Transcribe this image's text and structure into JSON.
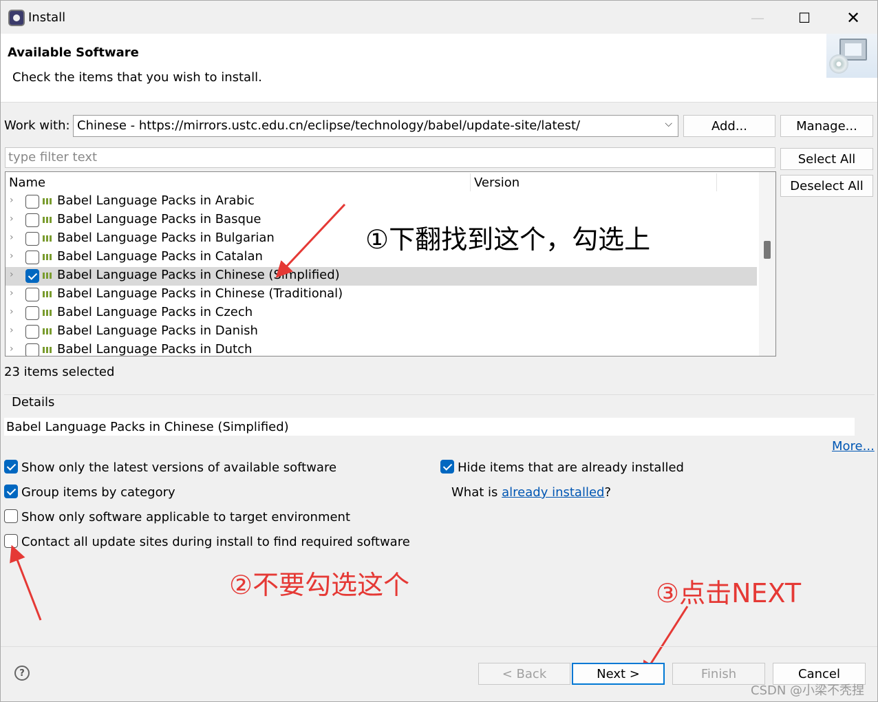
{
  "window": {
    "title": "Install",
    "controls": {
      "minimize": "—",
      "maximize": "☐",
      "close": "✕"
    }
  },
  "header": {
    "title": "Available Software",
    "subtitle": "Check the items that you wish to install."
  },
  "work_with": {
    "label": "Work with:",
    "value": "Chinese - https://mirrors.ustc.edu.cn/eclipse/technology/babel/update-site/latest/",
    "add_label": "Add...",
    "manage_label": "Manage..."
  },
  "filter": {
    "placeholder": "type filter text"
  },
  "side_buttons": {
    "select_all": "Select All",
    "deselect_all": "Deselect All"
  },
  "tree": {
    "columns": {
      "name": "Name",
      "version": "Version"
    },
    "rows": [
      {
        "label": "Babel Language Packs in Arabic",
        "checked": false
      },
      {
        "label": "Babel Language Packs in Basque",
        "checked": false
      },
      {
        "label": "Babel Language Packs in Bulgarian",
        "checked": false
      },
      {
        "label": "Babel Language Packs in Catalan",
        "checked": false
      },
      {
        "label": "Babel Language Packs in Chinese (Simplified)",
        "checked": true,
        "selected": true
      },
      {
        "label": "Babel Language Packs in Chinese (Traditional)",
        "checked": false
      },
      {
        "label": "Babel Language Packs in Czech",
        "checked": false
      },
      {
        "label": "Babel Language Packs in Danish",
        "checked": false
      },
      {
        "label": "Babel Language Packs in Dutch",
        "checked": false
      }
    ]
  },
  "status": {
    "selected_count": "23 items selected"
  },
  "details": {
    "label": "Details",
    "text": "Babel Language Packs in Chinese (Simplified)",
    "more_link": "More..."
  },
  "options": {
    "latest_versions": {
      "label": "Show only the latest versions of available software",
      "checked": true
    },
    "group_by_category": {
      "label": "Group items by category",
      "checked": true
    },
    "target_env": {
      "label": "Show only software applicable to target environment",
      "checked": false
    },
    "contact_sites": {
      "label": "Contact all update sites during install to find required software",
      "checked": false
    },
    "hide_installed": {
      "label": "Hide items that are already installed",
      "checked": true
    },
    "what_is_prefix": "What is ",
    "what_is_link": "already installed",
    "what_is_suffix": "?"
  },
  "annotations": {
    "step1": "①下翻找到这个，勾选上",
    "step2": "②不要勾选这个",
    "step3": "③点击NEXT"
  },
  "footer": {
    "help_icon": "?",
    "back_label": "< Back",
    "next_label": "Next >",
    "finish_label": "Finish",
    "cancel_label": "Cancel"
  },
  "watermark": "CSDN @小梁不秃捏",
  "colors": {
    "accent": "#0067c0",
    "annotation": "#e53935",
    "link": "#0056b3"
  }
}
